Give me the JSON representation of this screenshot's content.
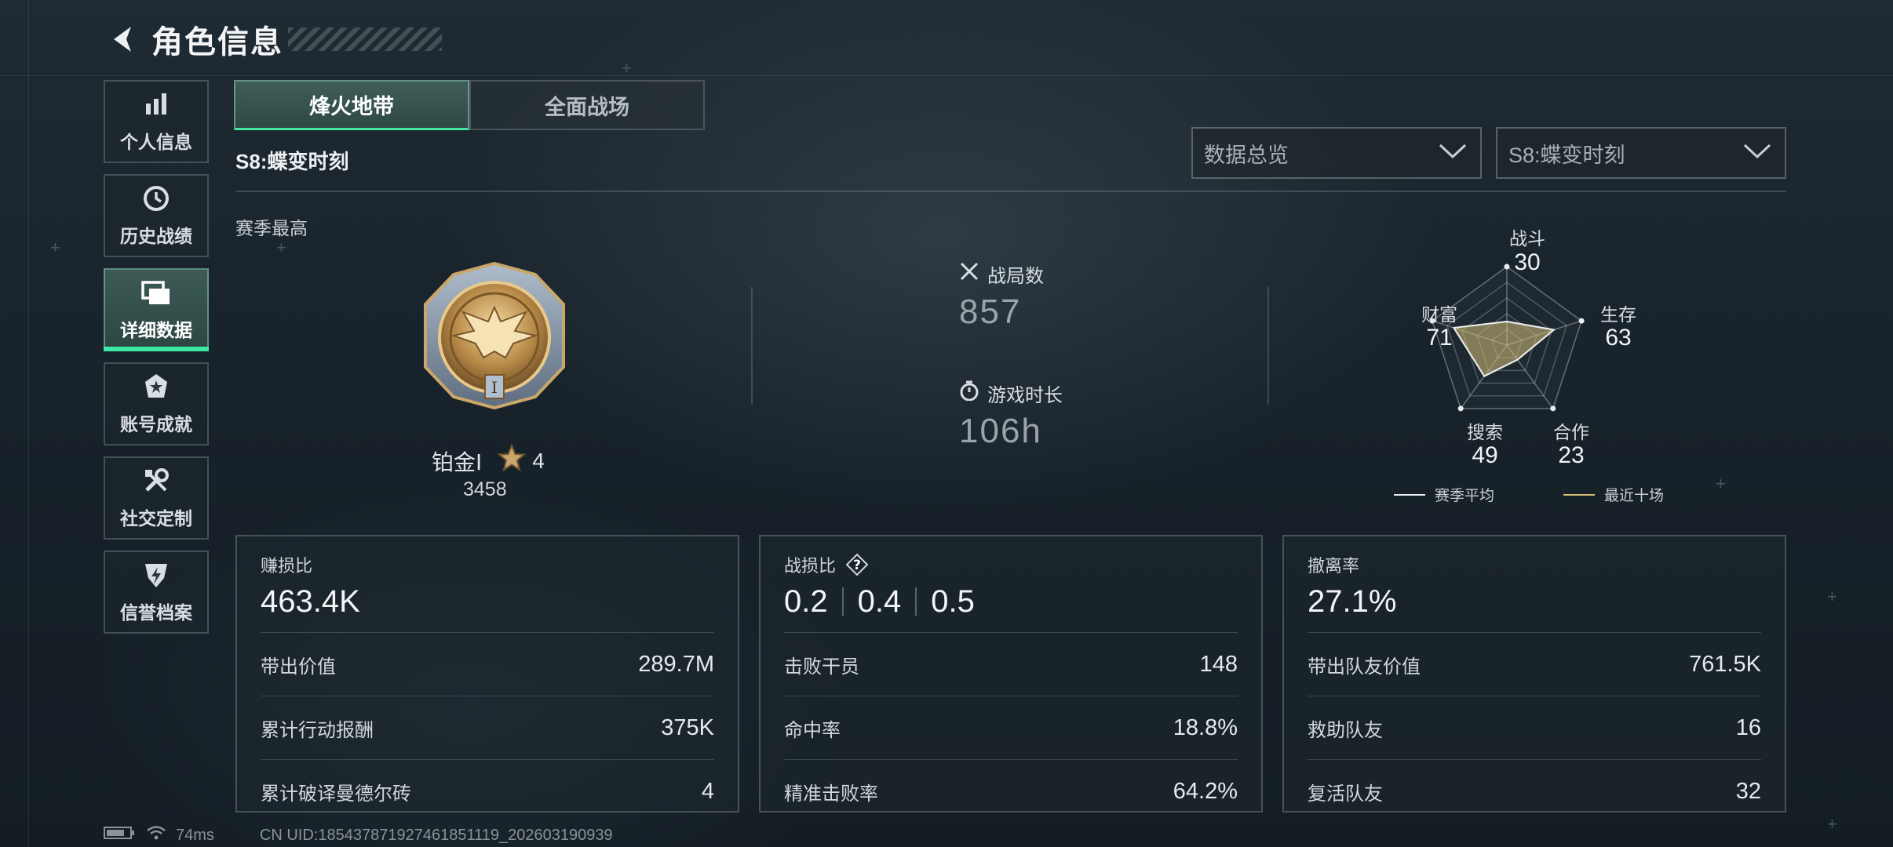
{
  "header": {
    "title": "角色信息"
  },
  "sidebar": {
    "items": [
      {
        "label": "个人信息",
        "icon": "bar-chart-icon"
      },
      {
        "label": "历史战绩",
        "icon": "history-clock-icon"
      },
      {
        "label": "详细数据",
        "icon": "folder-icon",
        "active": true
      },
      {
        "label": "账号成就",
        "icon": "achievement-badge-icon"
      },
      {
        "label": "社交定制",
        "icon": "wrench-screwdriver-icon"
      },
      {
        "label": "信誉档案",
        "icon": "shield-lightning-icon"
      }
    ]
  },
  "tabs": [
    {
      "label": "烽火地带",
      "active": true
    },
    {
      "label": "全面战场",
      "active": false
    }
  ],
  "season_title": "S8:蝶变时刻",
  "dropdowns": {
    "view": {
      "value": "数据总览"
    },
    "season": {
      "value": "S8:蝶变时刻"
    }
  },
  "season_best": {
    "label": "赛季最高",
    "rank_name": "铂金Ⅰ",
    "stars": "4",
    "points": "3458"
  },
  "overview": {
    "matches": {
      "label": "战局数",
      "value": "857"
    },
    "playtime": {
      "label": "游戏时长",
      "value": "106h"
    }
  },
  "radar": {
    "axes": [
      {
        "label": "战斗",
        "value": "30"
      },
      {
        "label": "生存",
        "value": "63"
      },
      {
        "label": "合作",
        "value": "23"
      },
      {
        "label": "搜索",
        "value": "49"
      },
      {
        "label": "财富",
        "value": "71"
      }
    ],
    "legend": {
      "season_avg": "赛季平均",
      "recent_ten": "最近十场"
    },
    "colors": {
      "season_avg": "#e8ecef",
      "recent_ten": "#d6c079"
    }
  },
  "cards": {
    "profit": {
      "title": "赚损比",
      "big": "463.4K",
      "rows": [
        {
          "label": "带出价值",
          "value": "289.7M"
        },
        {
          "label": "累计行动报酬",
          "value": "375K"
        },
        {
          "label": "累计破译曼德尔砖",
          "value": "4"
        }
      ]
    },
    "combat": {
      "title": "战损比",
      "help": "?",
      "ratios": [
        "0.2",
        "0.4",
        "0.5"
      ],
      "rows": [
        {
          "label": "击败干员",
          "value": "148"
        },
        {
          "label": "命中率",
          "value": "18.8%"
        },
        {
          "label": "精准击败率",
          "value": "64.2%"
        }
      ]
    },
    "extract": {
      "title": "撤离率",
      "big": "27.1%",
      "rows": [
        {
          "label": "带出队友价值",
          "value": "761.5K"
        },
        {
          "label": "救助队友",
          "value": "16"
        },
        {
          "label": "复活队友",
          "value": "32"
        }
      ]
    }
  },
  "footer": {
    "ping": "74ms",
    "uid": "CN UID:18543787192746185111​9_202603190939"
  }
}
